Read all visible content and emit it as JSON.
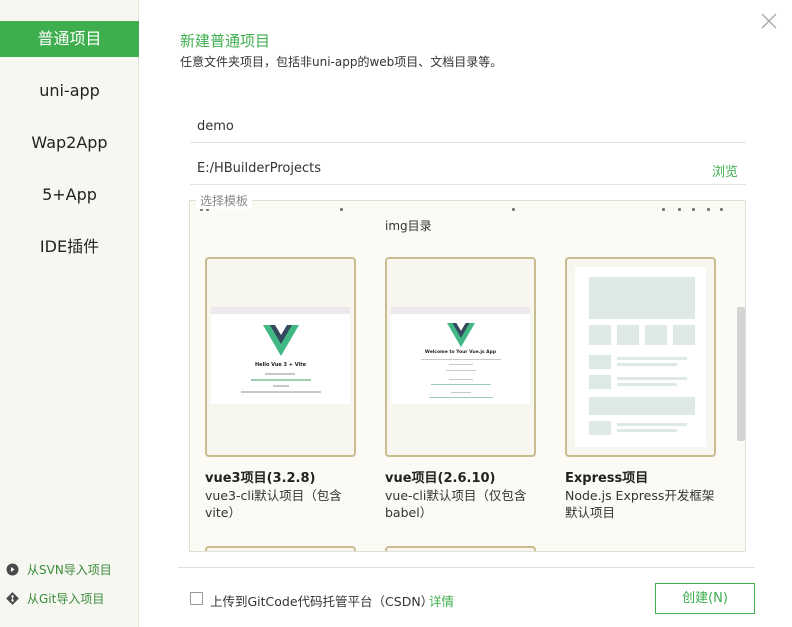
{
  "sidebar": {
    "items": [
      {
        "label": "普通项目"
      },
      {
        "label": "uni-app"
      },
      {
        "label": "Wap2App"
      },
      {
        "label": "5+App"
      },
      {
        "label": "IDE插件"
      }
    ],
    "import_svn": "从SVN导入项目",
    "import_git": "从Git导入项目"
  },
  "header": {
    "title": "新建普通项目",
    "subtitle": "任意文件夹项目，包括非uni-app的web项目、文档目录等。"
  },
  "form": {
    "project_name": "demo",
    "location": "E:/HBuilderProjects",
    "browse_label": "浏览"
  },
  "templates": {
    "label": "选择模板",
    "scroll_note": "img目录",
    "cards": [
      {
        "title": "vue3项目(3.2.8)",
        "desc": "vue3-cli默认项目（包含vite）",
        "shot_title": "Hello Vue 3 + Vite"
      },
      {
        "title": "vue项目(2.6.10)",
        "desc": "vue-cli默认项目（仅包含babel）",
        "shot_title": "Welcome to Your Vue.js App"
      },
      {
        "title": "Express项目",
        "desc": "Node.js Express开发框架默认项目"
      }
    ]
  },
  "footer": {
    "upload_label": "上传到GitCode代码托管平台（CSDN）",
    "details_label": "详情",
    "create_label": "创建(N)"
  },
  "colors": {
    "accent": "#3fae4f",
    "card_border": "#c9bc8f",
    "vue_green": "#41b883",
    "vue_dark": "#35495e"
  }
}
